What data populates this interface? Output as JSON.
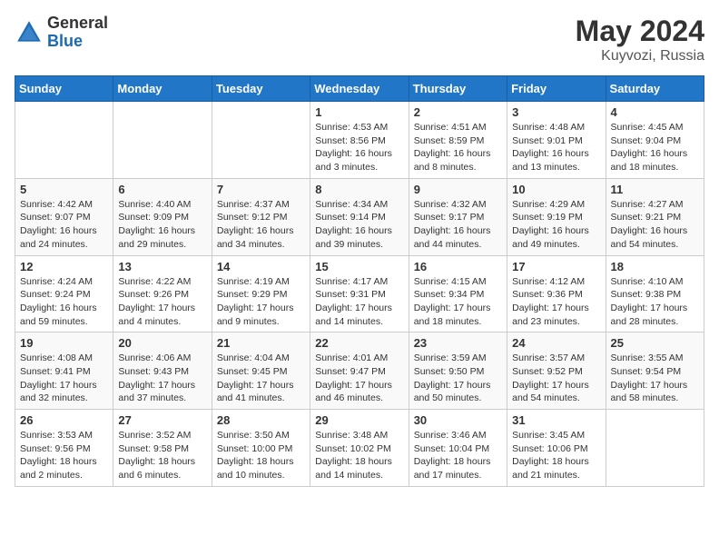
{
  "header": {
    "logo_general": "General",
    "logo_blue": "Blue",
    "title": "May 2024",
    "location": "Kuyvozi, Russia"
  },
  "days_of_week": [
    "Sunday",
    "Monday",
    "Tuesday",
    "Wednesday",
    "Thursday",
    "Friday",
    "Saturday"
  ],
  "weeks": [
    [
      {
        "day": "",
        "info": ""
      },
      {
        "day": "",
        "info": ""
      },
      {
        "day": "",
        "info": ""
      },
      {
        "day": "1",
        "info": "Sunrise: 4:53 AM\nSunset: 8:56 PM\nDaylight: 16 hours and 3 minutes."
      },
      {
        "day": "2",
        "info": "Sunrise: 4:51 AM\nSunset: 8:59 PM\nDaylight: 16 hours and 8 minutes."
      },
      {
        "day": "3",
        "info": "Sunrise: 4:48 AM\nSunset: 9:01 PM\nDaylight: 16 hours and 13 minutes."
      },
      {
        "day": "4",
        "info": "Sunrise: 4:45 AM\nSunset: 9:04 PM\nDaylight: 16 hours and 18 minutes."
      }
    ],
    [
      {
        "day": "5",
        "info": "Sunrise: 4:42 AM\nSunset: 9:07 PM\nDaylight: 16 hours and 24 minutes."
      },
      {
        "day": "6",
        "info": "Sunrise: 4:40 AM\nSunset: 9:09 PM\nDaylight: 16 hours and 29 minutes."
      },
      {
        "day": "7",
        "info": "Sunrise: 4:37 AM\nSunset: 9:12 PM\nDaylight: 16 hours and 34 minutes."
      },
      {
        "day": "8",
        "info": "Sunrise: 4:34 AM\nSunset: 9:14 PM\nDaylight: 16 hours and 39 minutes."
      },
      {
        "day": "9",
        "info": "Sunrise: 4:32 AM\nSunset: 9:17 PM\nDaylight: 16 hours and 44 minutes."
      },
      {
        "day": "10",
        "info": "Sunrise: 4:29 AM\nSunset: 9:19 PM\nDaylight: 16 hours and 49 minutes."
      },
      {
        "day": "11",
        "info": "Sunrise: 4:27 AM\nSunset: 9:21 PM\nDaylight: 16 hours and 54 minutes."
      }
    ],
    [
      {
        "day": "12",
        "info": "Sunrise: 4:24 AM\nSunset: 9:24 PM\nDaylight: 16 hours and 59 minutes."
      },
      {
        "day": "13",
        "info": "Sunrise: 4:22 AM\nSunset: 9:26 PM\nDaylight: 17 hours and 4 minutes."
      },
      {
        "day": "14",
        "info": "Sunrise: 4:19 AM\nSunset: 9:29 PM\nDaylight: 17 hours and 9 minutes."
      },
      {
        "day": "15",
        "info": "Sunrise: 4:17 AM\nSunset: 9:31 PM\nDaylight: 17 hours and 14 minutes."
      },
      {
        "day": "16",
        "info": "Sunrise: 4:15 AM\nSunset: 9:34 PM\nDaylight: 17 hours and 18 minutes."
      },
      {
        "day": "17",
        "info": "Sunrise: 4:12 AM\nSunset: 9:36 PM\nDaylight: 17 hours and 23 minutes."
      },
      {
        "day": "18",
        "info": "Sunrise: 4:10 AM\nSunset: 9:38 PM\nDaylight: 17 hours and 28 minutes."
      }
    ],
    [
      {
        "day": "19",
        "info": "Sunrise: 4:08 AM\nSunset: 9:41 PM\nDaylight: 17 hours and 32 minutes."
      },
      {
        "day": "20",
        "info": "Sunrise: 4:06 AM\nSunset: 9:43 PM\nDaylight: 17 hours and 37 minutes."
      },
      {
        "day": "21",
        "info": "Sunrise: 4:04 AM\nSunset: 9:45 PM\nDaylight: 17 hours and 41 minutes."
      },
      {
        "day": "22",
        "info": "Sunrise: 4:01 AM\nSunset: 9:47 PM\nDaylight: 17 hours and 46 minutes."
      },
      {
        "day": "23",
        "info": "Sunrise: 3:59 AM\nSunset: 9:50 PM\nDaylight: 17 hours and 50 minutes."
      },
      {
        "day": "24",
        "info": "Sunrise: 3:57 AM\nSunset: 9:52 PM\nDaylight: 17 hours and 54 minutes."
      },
      {
        "day": "25",
        "info": "Sunrise: 3:55 AM\nSunset: 9:54 PM\nDaylight: 17 hours and 58 minutes."
      }
    ],
    [
      {
        "day": "26",
        "info": "Sunrise: 3:53 AM\nSunset: 9:56 PM\nDaylight: 18 hours and 2 minutes."
      },
      {
        "day": "27",
        "info": "Sunrise: 3:52 AM\nSunset: 9:58 PM\nDaylight: 18 hours and 6 minutes."
      },
      {
        "day": "28",
        "info": "Sunrise: 3:50 AM\nSunset: 10:00 PM\nDaylight: 18 hours and 10 minutes."
      },
      {
        "day": "29",
        "info": "Sunrise: 3:48 AM\nSunset: 10:02 PM\nDaylight: 18 hours and 14 minutes."
      },
      {
        "day": "30",
        "info": "Sunrise: 3:46 AM\nSunset: 10:04 PM\nDaylight: 18 hours and 17 minutes."
      },
      {
        "day": "31",
        "info": "Sunrise: 3:45 AM\nSunset: 10:06 PM\nDaylight: 18 hours and 21 minutes."
      },
      {
        "day": "",
        "info": ""
      }
    ]
  ]
}
